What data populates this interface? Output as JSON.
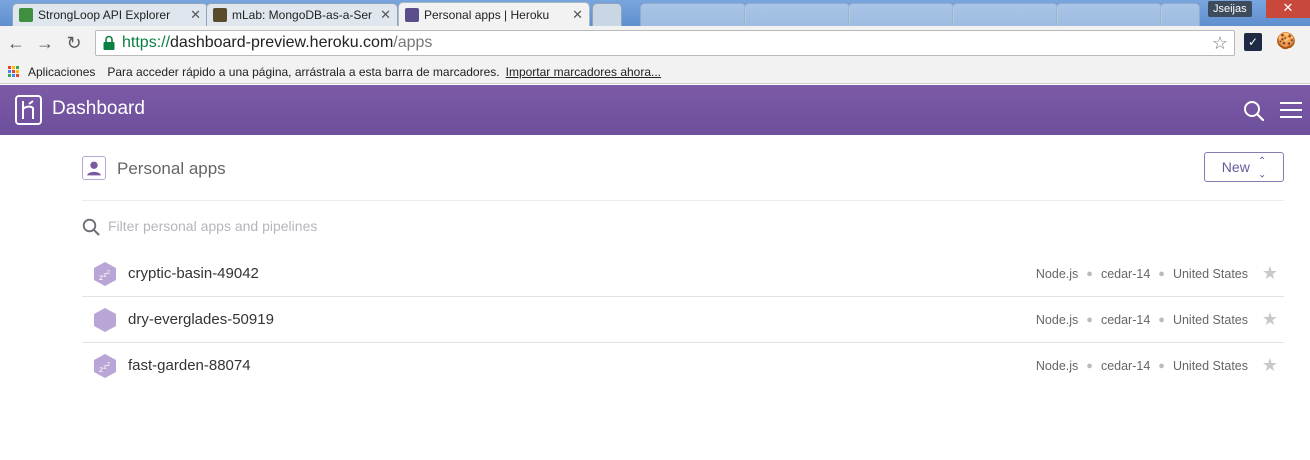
{
  "browser": {
    "tabs": [
      {
        "title": "StrongLoop API Explorer",
        "favicon_color": "#3f8f3f"
      },
      {
        "title": "mLab: MongoDB-as-a-Ser",
        "favicon_color": "#5a4b2a"
      },
      {
        "title": "Personal apps | Heroku",
        "favicon_color": "#5c4e8a",
        "active": true
      }
    ],
    "user_badge": "Jseijas",
    "url": {
      "scheme": "https://",
      "host": "dashboard-preview.heroku.com",
      "path": "/apps"
    },
    "bookmarks": {
      "apps_label": "Aplicaciones",
      "hint": "Para acceder rápido a una página, arrástrala a esta barra de marcadores.",
      "import_link": "Importar marcadores ahora..."
    }
  },
  "header": {
    "brand": "Dashboard",
    "color": "#79589f"
  },
  "section": {
    "title": "Personal apps",
    "new_button": "New"
  },
  "filter": {
    "placeholder": "Filter personal apps and pipelines"
  },
  "apps": [
    {
      "name": "cryptic-basin-49042",
      "language": "Node.js",
      "stack": "cedar-14",
      "region": "United States",
      "sleeping": true
    },
    {
      "name": "dry-everglades-50919",
      "language": "Node.js",
      "stack": "cedar-14",
      "region": "United States",
      "sleeping": false
    },
    {
      "name": "fast-garden-88074",
      "language": "Node.js",
      "stack": "cedar-14",
      "region": "United States",
      "sleeping": true
    }
  ],
  "icons": {
    "app_hex_color": "#b9a5d6",
    "accent": "#79589f"
  }
}
